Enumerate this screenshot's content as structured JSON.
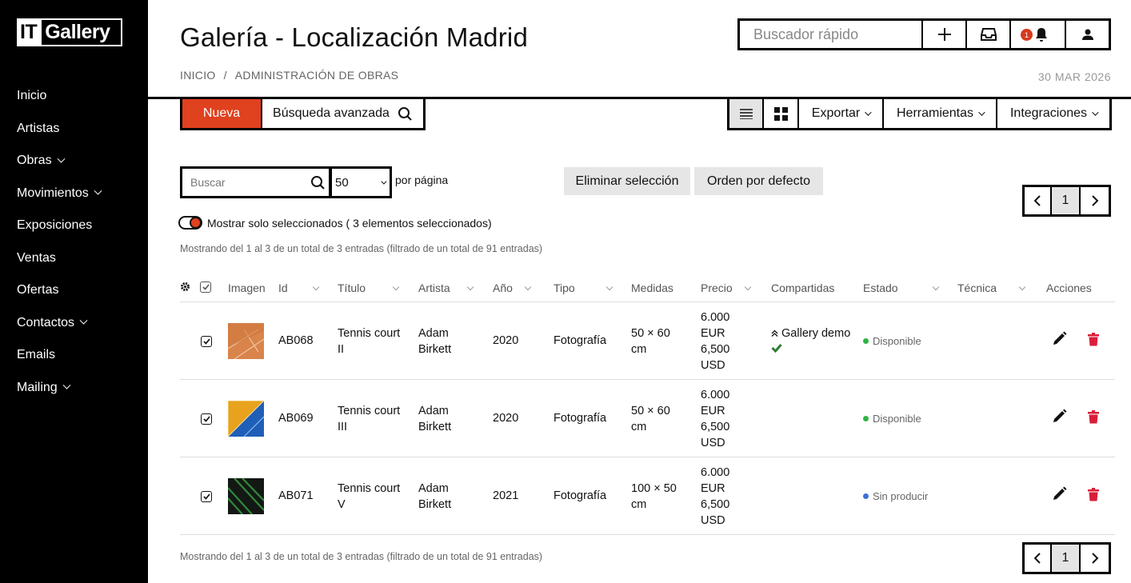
{
  "brand": {
    "logo_it": "IT",
    "logo_gallery": "Gallery"
  },
  "sidebar": {
    "items": [
      {
        "label": "Inicio",
        "has_sub": false
      },
      {
        "label": "Artistas",
        "has_sub": false
      },
      {
        "label": "Obras",
        "has_sub": true
      },
      {
        "label": "Movimientos",
        "has_sub": true
      },
      {
        "label": "Exposiciones",
        "has_sub": false
      },
      {
        "label": "Ventas",
        "has_sub": false
      },
      {
        "label": "Ofertas",
        "has_sub": false
      },
      {
        "label": "Contactos",
        "has_sub": true
      },
      {
        "label": "Emails",
        "has_sub": false
      },
      {
        "label": "Mailing",
        "has_sub": true
      }
    ]
  },
  "header": {
    "title": "Galería - Localización Madrid",
    "breadcrumb_home": "INICIO",
    "breadcrumb_sep": "/",
    "breadcrumb_current": "ADMINISTRACIÓN DE OBRAS",
    "date": "30 MAR 2026",
    "quick_search_placeholder": "Buscador rápido",
    "notification_count": "1"
  },
  "toolbar": {
    "new_label": "Nueva",
    "advanced_search_label": "Búsqueda avanzada",
    "export_label": "Exportar",
    "tools_label": "Herramientas",
    "integrations_label": "Integraciones",
    "active_view": "list"
  },
  "filters": {
    "search_placeholder": "Buscar",
    "per_page_value": "50",
    "per_page_label": "por página",
    "delete_selection_label": "Eliminar selección",
    "default_order_label": "Orden por defecto",
    "toggle_label": "Mostrar solo seleccionados ( 3 elementos seleccionados)",
    "toggle_on": true,
    "current_page": "1"
  },
  "summary_text": "Mostrando del 1 al 3 de un total de 3 entradas (filtrado de un total de 91 entradas)",
  "table": {
    "columns": [
      "Imagen",
      "Id",
      "Título",
      "Artista",
      "Año",
      "Tipo",
      "Medidas",
      "Precio",
      "Compartidas",
      "Estado",
      "Técnica",
      "Acciones"
    ],
    "rows": [
      {
        "selected": true,
        "id": "AB068",
        "title_l1": "Tennis court",
        "title_l2": "II",
        "artist_l1": "Adam",
        "artist_l2": "Birkett",
        "year": "2020",
        "type": "Fotografía",
        "size_l1": "50 × 60",
        "size_l2": "cm",
        "price_l1": "6.000",
        "price_l2": "EUR",
        "price_l3": "6,500",
        "price_l4": "USD",
        "shared": "Gallery demo",
        "status": "Disponible",
        "status_color": "#2fb344",
        "thumb": "orange"
      },
      {
        "selected": true,
        "id": "AB069",
        "title_l1": "Tennis court",
        "title_l2": "III",
        "artist_l1": "Adam",
        "artist_l2": "Birkett",
        "year": "2020",
        "type": "Fotografía",
        "size_l1": "50 × 60",
        "size_l2": "cm",
        "price_l1": "6.000",
        "price_l2": "EUR",
        "price_l3": "6,500",
        "price_l4": "USD",
        "shared": "",
        "status": "Disponible",
        "status_color": "#2fb344",
        "thumb": "yellow-blue"
      },
      {
        "selected": true,
        "id": "AB071",
        "title_l1": "Tennis court",
        "title_l2": "V",
        "artist_l1": "Adam",
        "artist_l2": "Birkett",
        "year": "2021",
        "type": "Fotografía",
        "size_l1": "100 × 50",
        "size_l2": "cm",
        "price_l1": "6.000",
        "price_l2": "EUR",
        "price_l3": "6,500",
        "price_l4": "USD",
        "shared": "",
        "status": "Sin producir",
        "status_color": "#3d6fd6",
        "thumb": "dark-green"
      }
    ]
  },
  "colors": {
    "accent": "#e0411f",
    "delete_icon": "#d91e3a",
    "shared_check": "#2e7d32"
  }
}
